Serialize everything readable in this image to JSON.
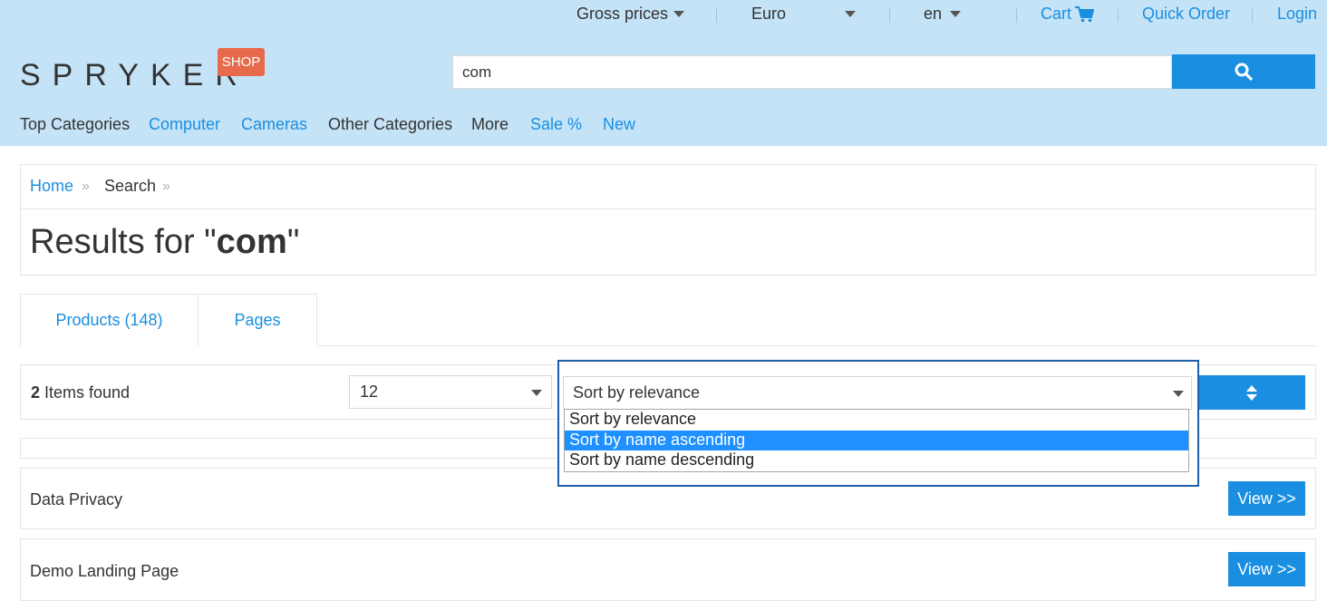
{
  "topbar": {
    "price_mode": "Gross prices",
    "currency": "Euro",
    "language": "en",
    "cart": "Cart",
    "quick_order": "Quick Order",
    "login": "Login"
  },
  "logo": {
    "text": "SPRYKER",
    "badge": "SHOP"
  },
  "search": {
    "value": "com",
    "button_icon": "search-icon"
  },
  "nav": [
    "Top Categories",
    "Computer",
    "Cameras",
    "Other Categories",
    "More",
    "Sale %",
    "New"
  ],
  "breadcrumb": {
    "home": "Home",
    "current": "Search",
    "separator": "»"
  },
  "title": {
    "prefix": "Results for \"",
    "query": "com",
    "suffix": "\""
  },
  "tabs": [
    "Products (148)",
    "Pages"
  ],
  "toolbar": {
    "items_count": "2",
    "items_label": " Items found",
    "per_page": "12",
    "sort_selected": "Sort by relevance",
    "sort_direction_icon": "sort-icon"
  },
  "sort_options": [
    "Sort by relevance",
    "Sort by name ascending",
    "Sort by name descending"
  ],
  "highlighted_option": "Sort by name ascending",
  "results": [
    {
      "name": "Data Privacy",
      "button": "View >>"
    },
    {
      "name": "Demo Landing Page",
      "button": "View >>"
    }
  ],
  "colors": {
    "header_bg": "#c5e3f7",
    "accent": "#1a8ee0",
    "badge": "#e76a4c",
    "option_highlight": "#1e90ff"
  }
}
